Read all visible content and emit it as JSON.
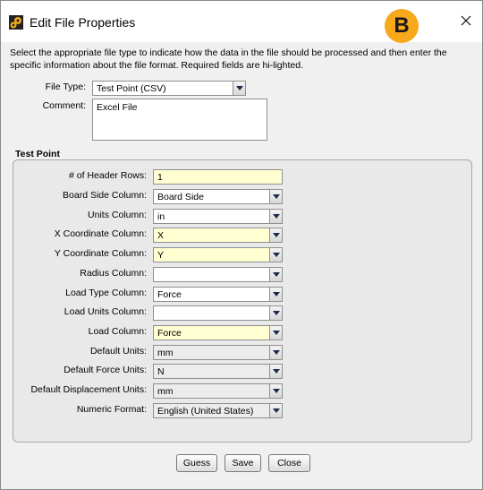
{
  "window": {
    "title": "Edit File Properties",
    "badge": "B"
  },
  "instructions": "Select the appropriate file type to indicate how the data in the file should be processed and then enter the specific information about the file format. Required fields are hi-lighted.",
  "file_type": {
    "label": "File Type:",
    "value": "Test Point (CSV)"
  },
  "comment": {
    "label": "Comment:",
    "value": "Excel File"
  },
  "test_point": {
    "title": "Test Point",
    "fields": [
      {
        "label": "# of Header Rows:",
        "value": "1",
        "kind": "text",
        "required": true
      },
      {
        "label": "Board Side Column:",
        "value": "Board Side",
        "kind": "combo",
        "required": false
      },
      {
        "label": "Units Column:",
        "value": "in",
        "kind": "combo",
        "required": false
      },
      {
        "label": "X Coordinate Column:",
        "value": "X",
        "kind": "combo",
        "required": true
      },
      {
        "label": "Y Coordinate Column:",
        "value": "Y",
        "kind": "combo",
        "required": true
      },
      {
        "label": "Radius Column:",
        "value": "",
        "kind": "combo",
        "required": false
      },
      {
        "label": "Load Type Column:",
        "value": "Force",
        "kind": "combo",
        "required": false
      },
      {
        "label": "Load Units Column:",
        "value": "",
        "kind": "combo",
        "required": false
      },
      {
        "label": "Load Column:",
        "value": "Force",
        "kind": "combo",
        "required": true
      },
      {
        "label": "Default Units:",
        "value": "mm",
        "kind": "combo",
        "required": false,
        "disabled": true
      },
      {
        "label": "Default Force Units:",
        "value": "N",
        "kind": "combo",
        "required": false,
        "disabled": true
      },
      {
        "label": "Default Displacement Units:",
        "value": "mm",
        "kind": "combo",
        "required": false,
        "disabled": true
      },
      {
        "label": "Numeric Format:",
        "value": "English (United States)",
        "kind": "combo",
        "required": false,
        "disabled": true
      }
    ]
  },
  "buttons": {
    "guess": "Guess",
    "save": "Save",
    "close": "Close"
  },
  "colors": {
    "required_bg": "#ffffd2",
    "badge": "#f7a81b"
  }
}
